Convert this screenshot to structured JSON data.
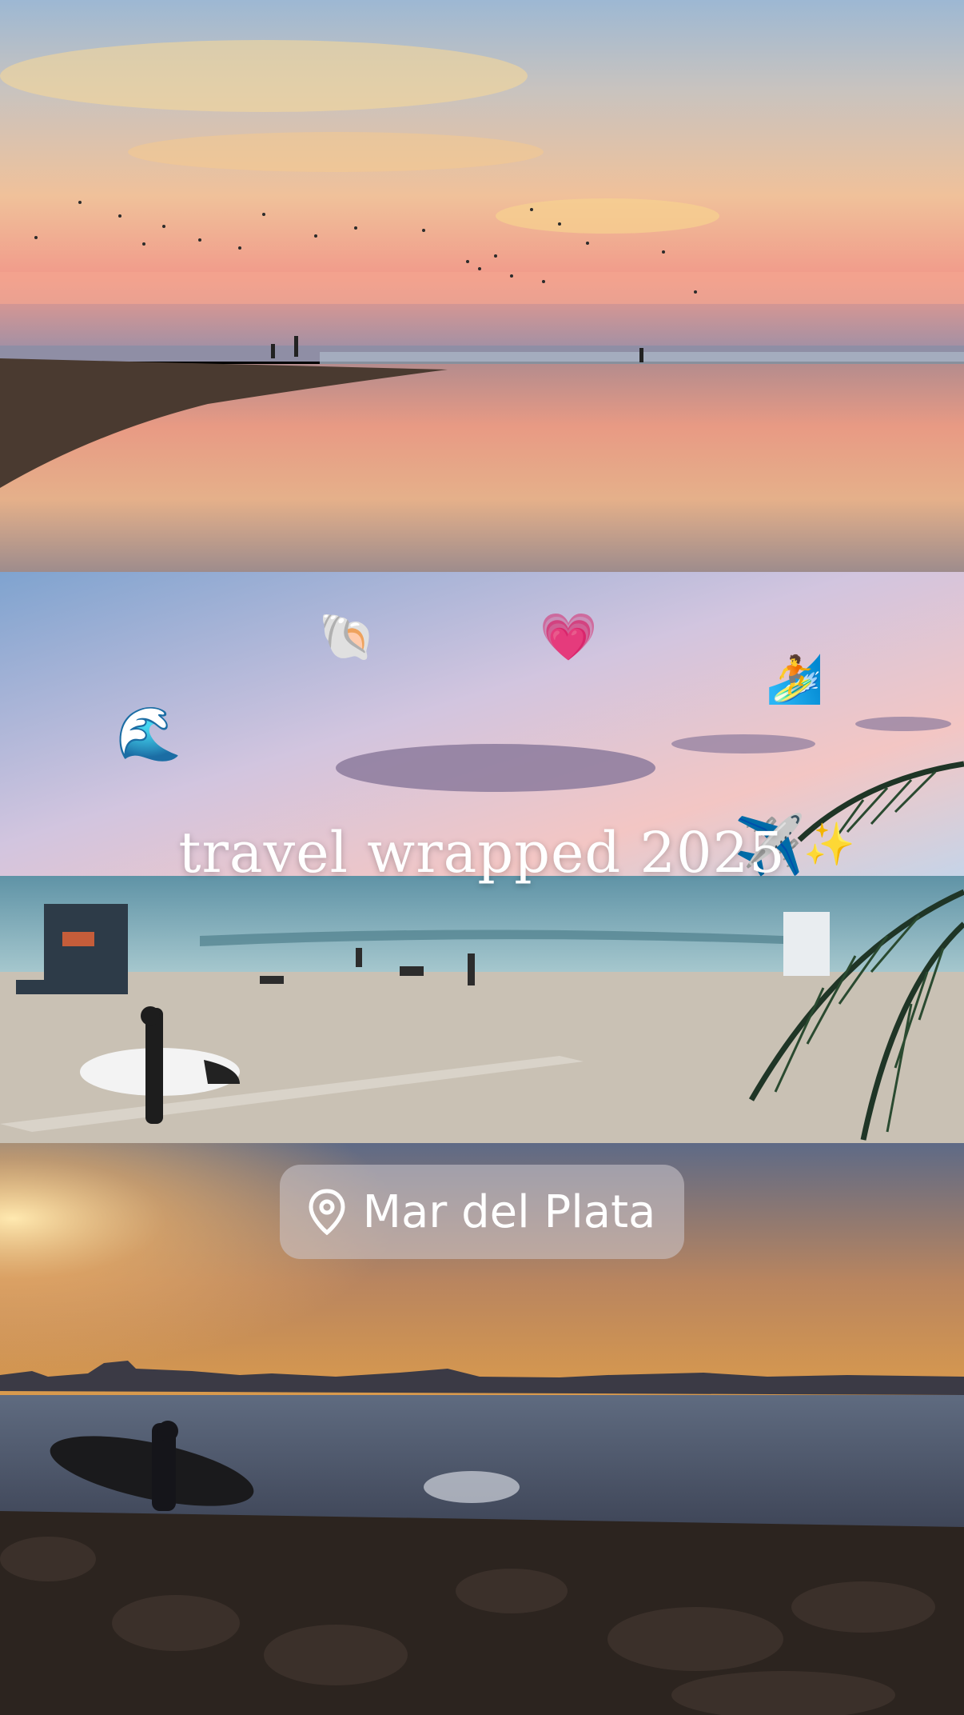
{
  "story": {
    "title": "travel wrapped 2025",
    "location": {
      "icon": "location-pin-icon",
      "label": "Mar del Plata"
    },
    "stickers": [
      "spiral-shell",
      "pink-heart",
      "person-surfing",
      "water-wave",
      "airplane",
      "sparkles"
    ]
  },
  "colors": {
    "sunset_pink": "#f2a4a0",
    "sky_blue": "#9fc3e6",
    "sea_teal": "#6fa7b4",
    "sand": "#c9c1b4",
    "dusk_gold": "#e7a14a",
    "dusk_blue": "#5e6a86"
  }
}
